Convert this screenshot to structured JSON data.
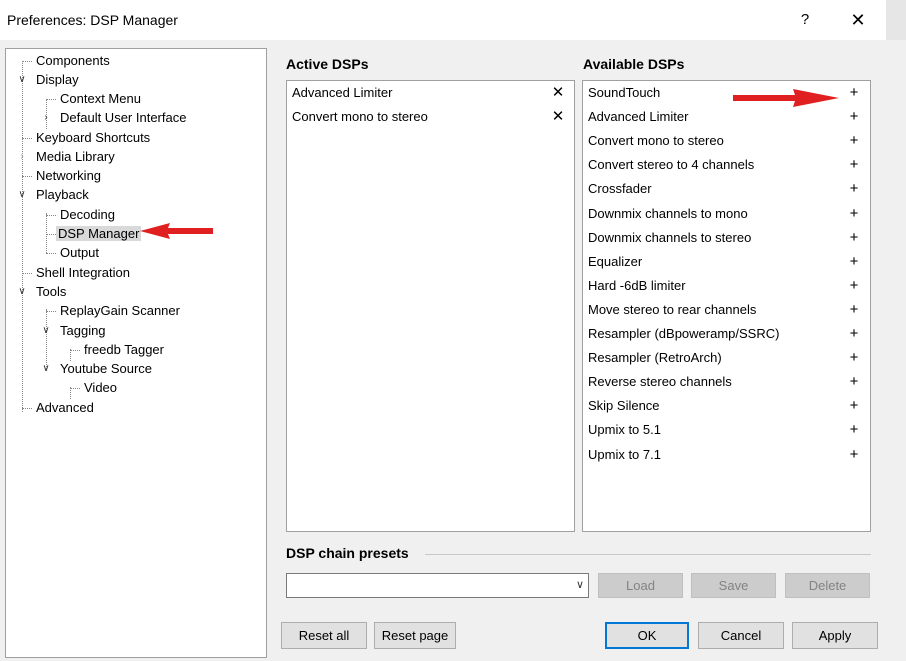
{
  "window": {
    "title": "Preferences: DSP Manager",
    "help_label": "?",
    "close_label": "✕"
  },
  "tree": {
    "items": [
      {
        "label": "Components"
      },
      {
        "label": "Display"
      },
      {
        "label": "Context Menu"
      },
      {
        "label": "Default User Interface"
      },
      {
        "label": "Keyboard Shortcuts"
      },
      {
        "label": "Media Library"
      },
      {
        "label": "Networking"
      },
      {
        "label": "Playback"
      },
      {
        "label": "Decoding"
      },
      {
        "label": "DSP Manager"
      },
      {
        "label": "Output"
      },
      {
        "label": "Shell Integration"
      },
      {
        "label": "Tools"
      },
      {
        "label": "ReplayGain Scanner"
      },
      {
        "label": "Tagging"
      },
      {
        "label": "freedb Tagger"
      },
      {
        "label": "Youtube Source"
      },
      {
        "label": "Video"
      },
      {
        "label": "Advanced"
      }
    ],
    "selected": "DSP Manager"
  },
  "active": {
    "title": "Active DSPs",
    "remove_symbol": "✕",
    "items": [
      "Advanced Limiter",
      "Convert mono to stereo"
    ]
  },
  "available": {
    "title": "Available DSPs",
    "add_symbol": "+",
    "items": [
      "SoundTouch",
      "Advanced Limiter",
      "Convert mono to stereo",
      "Convert stereo to 4 channels",
      "Crossfader",
      "Downmix channels to mono",
      "Downmix channels to stereo",
      "Equalizer",
      "Hard -6dB limiter",
      "Move stereo to rear channels",
      "Resampler (dBpoweramp/SSRC)",
      "Resampler (RetroArch)",
      "Reverse stereo channels",
      "Skip Silence",
      "Upmix to 5.1",
      "Upmix to 7.1"
    ]
  },
  "presets": {
    "title": "DSP chain presets",
    "value": "",
    "load_label": "Load",
    "save_label": "Save",
    "delete_label": "Delete"
  },
  "footer": {
    "reset_all_label": "Reset all",
    "reset_page_label": "Reset page",
    "ok_label": "OK",
    "cancel_label": "Cancel",
    "apply_label": "Apply"
  },
  "annotations": {
    "arrow_color": "#e02020"
  }
}
